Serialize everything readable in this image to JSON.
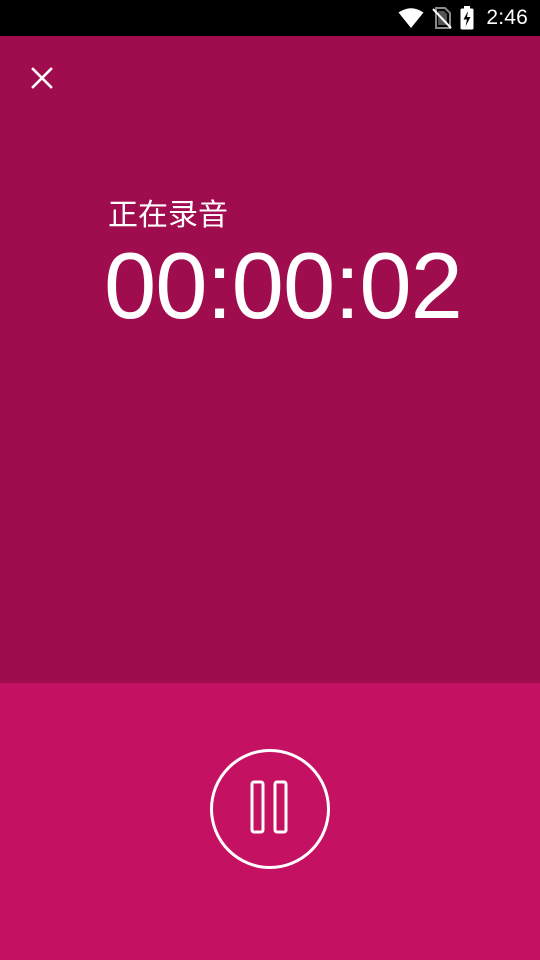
{
  "status_bar": {
    "time": "2:46",
    "icons": [
      "wifi-icon",
      "no-sim-icon",
      "battery-charging-icon"
    ]
  },
  "colors": {
    "top_panel": "#A00D4E",
    "bottom_panel": "#C51162",
    "foreground": "#FFFFFF"
  },
  "recorder": {
    "close_icon": "close-icon",
    "status_label": "正在录音",
    "elapsed_time": "00:00:02",
    "pause_icon": "pause-icon"
  }
}
